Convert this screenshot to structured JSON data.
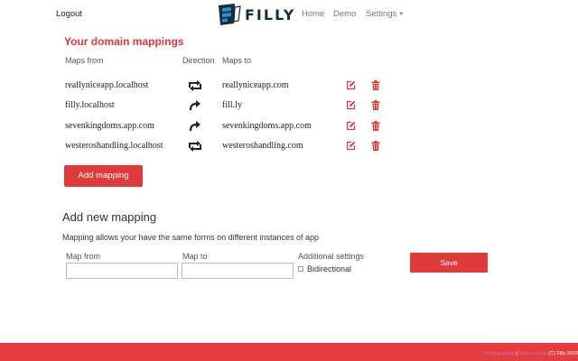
{
  "header": {
    "logout_label": "Logout",
    "logo_text": "FILLY",
    "nav": {
      "home": "Home",
      "demo": "Demo",
      "settings": "Settings"
    }
  },
  "mappings": {
    "title": "Your domain mappings",
    "columns": {
      "from": "Maps from",
      "direction": "Direction",
      "to": "Maps to"
    },
    "rows": [
      {
        "from": "reallyniceapp.localhost",
        "direction": "bidirectional",
        "to": "reallyniceapp.com"
      },
      {
        "from": "filly.localhost",
        "direction": "one-way",
        "to": "fill.ly"
      },
      {
        "from": "sevenkingdoms.app.com",
        "direction": "one-way",
        "to": "sevenkingdoms.app.com"
      },
      {
        "from": "westeroshandling.localhost",
        "direction": "bidirectional",
        "to": "westeroshandling.com"
      }
    ],
    "add_button": "Add mapping"
  },
  "new_mapping": {
    "title": "Add new mapping",
    "description": "Mapping allows your have the same forms on different instances of app",
    "map_from_label": "Map from",
    "map_from_value": "",
    "map_to_label": "Map to",
    "map_to_value": "",
    "additional_label": "Additional settings",
    "bidirectional_label": "Bidirectional",
    "bidirectional_checked": false,
    "save_button": "Save"
  },
  "footer": {
    "link1": "Privacy policy",
    "separator": "|",
    "link2": "Terms of use",
    "copyright": "(C) Filly 2018"
  },
  "colors": {
    "accent": "#df3b3b",
    "title_red": "#d9383a",
    "logo_dark": "#1c2b3a",
    "logo_blue": "#2a8fd6",
    "footer_bg": "#e53d3d"
  },
  "icons": {
    "edit": "edit-icon",
    "delete": "trash-icon",
    "bidirectional": "repeat-icon",
    "one_way": "share-arrow-icon"
  }
}
